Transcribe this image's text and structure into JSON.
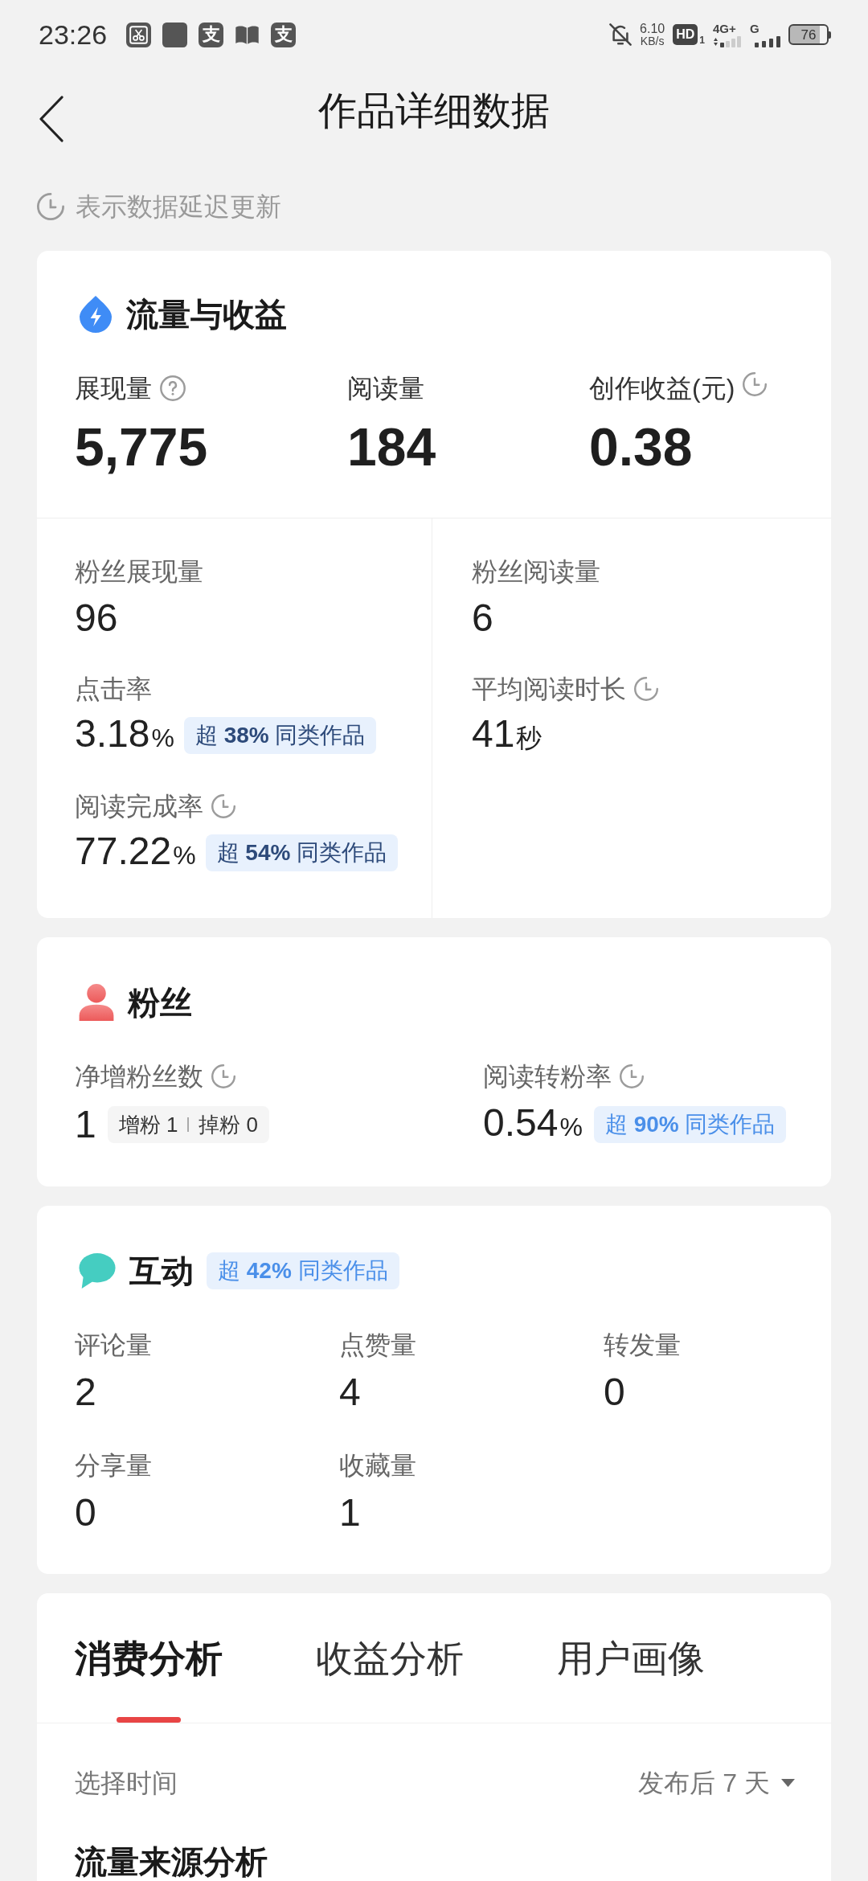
{
  "status_bar": {
    "time": "23:26",
    "notifications": [
      {
        "kind": "scissors"
      },
      {
        "kind": "square"
      },
      {
        "kind": "glyph",
        "text": "支"
      },
      {
        "kind": "book"
      },
      {
        "kind": "glyph",
        "text": "支"
      }
    ],
    "speed_value": "6.10",
    "speed_unit": "KB/s",
    "hd_label": "HD",
    "sim_slot": "1",
    "network_primary": "4G+",
    "network_secondary": "G",
    "battery": "76"
  },
  "header": {
    "title": "作品详细数据"
  },
  "delay_note": "表示数据延迟更新",
  "traffic_card": {
    "title": "流量与收益",
    "headline_metrics": [
      {
        "label": "展现量",
        "help": true,
        "delayed": false,
        "value": "5,775"
      },
      {
        "label": "阅读量",
        "help": false,
        "delayed": false,
        "value": "184"
      },
      {
        "label": "创作收益(元)",
        "help": false,
        "delayed": true,
        "value": "0.38"
      }
    ],
    "columns": [
      [
        {
          "label": "粉丝展现量",
          "delayed": false,
          "value": "96"
        },
        {
          "label": "点击率",
          "delayed": false,
          "value": "3.18",
          "unit": "%",
          "badge": {
            "text": "超 **38%** 同类作品",
            "kind": "strong"
          }
        },
        {
          "label": "阅读完成率",
          "delayed": true,
          "value": "77.22",
          "unit": "%",
          "badge": {
            "text": "超 **54%** 同类作品",
            "kind": "strong"
          }
        }
      ],
      [
        {
          "label": "粉丝阅读量",
          "delayed": false,
          "value": "6"
        },
        {
          "label": "平均阅读时长",
          "delayed": true,
          "value": "41",
          "unit": "秒"
        }
      ]
    ]
  },
  "fans_card": {
    "title": "粉丝",
    "metrics": [
      {
        "label": "净增粉丝数",
        "delayed": true,
        "value": "1",
        "breakdown": [
          "增粉 1",
          "掉粉 0"
        ]
      },
      {
        "label": "阅读转粉率",
        "delayed": true,
        "value": "0.54",
        "unit": "%",
        "badge": {
          "text": "超 **90%** 同类作品",
          "kind": "plain"
        }
      }
    ]
  },
  "interaction_card": {
    "title": "互动",
    "badge": {
      "text": "超 **42%** 同类作品",
      "kind": "plain"
    },
    "metrics": [
      {
        "label": "评论量",
        "value": "2"
      },
      {
        "label": "点赞量",
        "value": "4"
      },
      {
        "label": "转发量",
        "value": "0"
      },
      {
        "label": "分享量",
        "value": "0"
      },
      {
        "label": "收藏量",
        "value": "1"
      }
    ]
  },
  "analysis_card": {
    "tabs": [
      {
        "label": "消费分析",
        "selected": true
      },
      {
        "label": "收益分析",
        "selected": false
      },
      {
        "label": "用户画像",
        "selected": false
      }
    ],
    "time_filter": {
      "label": "选择时间",
      "value": "发布后 7 天"
    },
    "section_title": "流量来源分析"
  }
}
